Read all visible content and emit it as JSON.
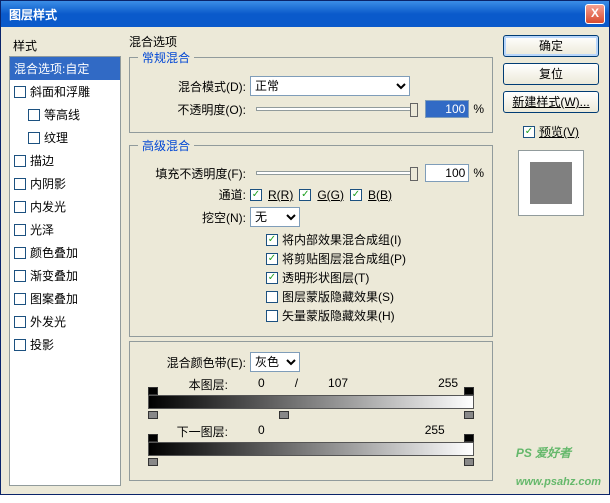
{
  "window": {
    "title": "图层样式",
    "close": "X"
  },
  "sidebar": {
    "header": "样式",
    "items": [
      {
        "label": "混合选项:自定",
        "selected": true
      },
      {
        "label": "斜面和浮雕",
        "hasCheck": true
      },
      {
        "label": "等高线",
        "hasCheck": true,
        "child": true
      },
      {
        "label": "纹理",
        "hasCheck": true,
        "child": true
      },
      {
        "label": "描边",
        "hasCheck": true
      },
      {
        "label": "内阴影",
        "hasCheck": true
      },
      {
        "label": "内发光",
        "hasCheck": true
      },
      {
        "label": "光泽",
        "hasCheck": true
      },
      {
        "label": "颜色叠加",
        "hasCheck": true
      },
      {
        "label": "渐变叠加",
        "hasCheck": true
      },
      {
        "label": "图案叠加",
        "hasCheck": true
      },
      {
        "label": "外发光",
        "hasCheck": true
      },
      {
        "label": "投影",
        "hasCheck": true
      }
    ]
  },
  "main": {
    "heading": "混合选项",
    "general": {
      "legend": "常规混合",
      "mode_label": "混合模式(D):",
      "mode_value": "正常",
      "opacity_label": "不透明度(O):",
      "opacity_value": "100",
      "opacity_unit": "%"
    },
    "advanced": {
      "legend": "高级混合",
      "fill_label": "填充不透明度(F):",
      "fill_value": "100",
      "fill_unit": "%",
      "channels_label": "通道:",
      "ch_r": "R(R)",
      "ch_g": "G(G)",
      "ch_b": "B(B)",
      "knockout_label": "挖空(N):",
      "knockout_value": "无",
      "opts": [
        {
          "label": "将内部效果混合成组(I)",
          "checked": true
        },
        {
          "label": "将剪贴图层混合成组(P)",
          "checked": true
        },
        {
          "label": "透明形状图层(T)",
          "checked": true
        },
        {
          "label": "图层蒙版隐藏效果(S)",
          "checked": false
        },
        {
          "label": "矢量蒙版隐藏效果(H)",
          "checked": false
        }
      ]
    },
    "blendif": {
      "label": "混合颜色带(E):",
      "value": "灰色",
      "this_label": "本图层:",
      "this_v1": "0",
      "this_v2": "/",
      "this_v3": "107",
      "this_v4": "255",
      "under_label": "下一图层:",
      "under_v1": "0",
      "under_v2": "255"
    }
  },
  "right": {
    "ok": "确定",
    "cancel": "复位",
    "newstyle": "新建样式(W)...",
    "preview": "预览(V)"
  },
  "watermark": {
    "main": "PS 爱好者",
    "sub": "www.psahz.com"
  }
}
